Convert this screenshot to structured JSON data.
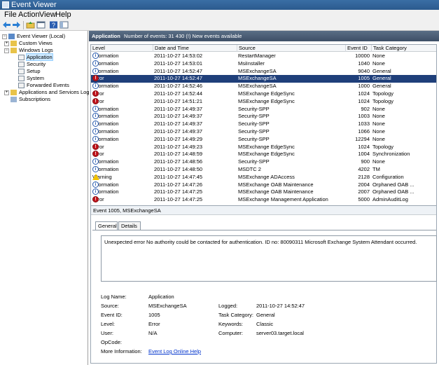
{
  "window": {
    "title": "Event Viewer"
  },
  "menu": [
    "File",
    "Action",
    "View",
    "Help"
  ],
  "toolbar_icons": [
    "back-icon",
    "forward-icon",
    "up-folder-icon",
    "properties-icon",
    "help-icon",
    "console-tree-icon"
  ],
  "tree": [
    {
      "label": "Event Viewer (Local)",
      "level": 0,
      "expander": "−",
      "icon": "event-viewer-icon"
    },
    {
      "label": "Custom Views",
      "level": 1,
      "expander": "+",
      "icon": "folder-icon"
    },
    {
      "label": "Windows Logs",
      "level": 1,
      "expander": "−",
      "icon": "folder-icon"
    },
    {
      "label": "Application",
      "level": 2,
      "expander": "",
      "icon": "log-icon",
      "selected": true
    },
    {
      "label": "Security",
      "level": 2,
      "expander": "",
      "icon": "log-icon"
    },
    {
      "label": "Setup",
      "level": 2,
      "expander": "",
      "icon": "log-icon"
    },
    {
      "label": "System",
      "level": 2,
      "expander": "",
      "icon": "log-icon"
    },
    {
      "label": "Forwarded Events",
      "level": 2,
      "expander": "",
      "icon": "log-icon"
    },
    {
      "label": "Applications and Services Logs",
      "level": 1,
      "expander": "+",
      "icon": "folder-icon"
    },
    {
      "label": "Subscriptions",
      "level": 1,
      "expander": "",
      "icon": "subscriptions-icon"
    }
  ],
  "pane": {
    "name": "Application",
    "count_text": "Number of events: 31 430 (!) New events available"
  },
  "columns": [
    "Level",
    "Date and Time",
    "Source",
    "Event ID",
    "Task Category"
  ],
  "events": [
    {
      "level": "Information",
      "date": "2011-10-27 14:53:02",
      "source": "RestartManager",
      "id": "10000",
      "category": "None"
    },
    {
      "level": "Information",
      "date": "2011-10-27 14:53:01",
      "source": "MsiInstaller",
      "id": "1040",
      "category": "None"
    },
    {
      "level": "Information",
      "date": "2011-10-27 14:52:47",
      "source": "MSExchangeSA",
      "id": "9040",
      "category": "General"
    },
    {
      "level": "Error",
      "date": "2011-10-27 14:52:47",
      "source": "MSExchangeSA",
      "id": "1005",
      "category": "General",
      "selected": true
    },
    {
      "level": "Information",
      "date": "2011-10-27 14:52:46",
      "source": "MSExchangeSA",
      "id": "1000",
      "category": "General"
    },
    {
      "level": "Error",
      "date": "2011-10-27 14:52:44",
      "source": "MSExchange EdgeSync",
      "id": "1024",
      "category": "Topology"
    },
    {
      "level": "Error",
      "date": "2011-10-27 14:51:21",
      "source": "MSExchange EdgeSync",
      "id": "1024",
      "category": "Topology"
    },
    {
      "level": "Information",
      "date": "2011-10-27 14:49:37",
      "source": "Security-SPP",
      "id": "902",
      "category": "None"
    },
    {
      "level": "Information",
      "date": "2011-10-27 14:49:37",
      "source": "Security-SPP",
      "id": "1003",
      "category": "None"
    },
    {
      "level": "Information",
      "date": "2011-10-27 14:49:37",
      "source": "Security-SPP",
      "id": "1033",
      "category": "None"
    },
    {
      "level": "Information",
      "date": "2011-10-27 14:49:37",
      "source": "Security-SPP",
      "id": "1066",
      "category": "None"
    },
    {
      "level": "Information",
      "date": "2011-10-27 14:49:29",
      "source": "Security-SPP",
      "id": "12294",
      "category": "None"
    },
    {
      "level": "Error",
      "date": "2011-10-27 14:49:23",
      "source": "MSExchange EdgeSync",
      "id": "1024",
      "category": "Topology"
    },
    {
      "level": "Error",
      "date": "2011-10-27 14:48:59",
      "source": "MSExchange EdgeSync",
      "id": "1004",
      "category": "Synchronization"
    },
    {
      "level": "Information",
      "date": "2011-10-27 14:48:56",
      "source": "Security-SPP",
      "id": "900",
      "category": "None"
    },
    {
      "level": "Information",
      "date": "2011-10-27 14:48:50",
      "source": "MSDTC 2",
      "id": "4202",
      "category": "TM"
    },
    {
      "level": "Warning",
      "date": "2011-10-27 14:47:45",
      "source": "MSExchange ADAccess",
      "id": "2128",
      "category": "Configuration"
    },
    {
      "level": "Information",
      "date": "2011-10-27 14:47:26",
      "source": "MSExchange OAB Maintenance",
      "id": "2004",
      "category": "Orphaned OAB ..."
    },
    {
      "level": "Information",
      "date": "2011-10-27 14:47:25",
      "source": "MSExchange OAB Maintenance",
      "id": "2007",
      "category": "Orphaned OAB ..."
    },
    {
      "level": "Error",
      "date": "2011-10-27 14:47:25",
      "source": "MSExchange Management Application",
      "id": "5000",
      "category": "AdminAuditLog"
    }
  ],
  "detail": {
    "title": "Event 1005, MSExchangeSA",
    "tabs": [
      "General",
      "Details"
    ],
    "message": "Unexpected error No authority could be contacted for authentication. ID no: 80090311 Microsoft Exchange System Attendant  occurred.",
    "fields": {
      "log_name_label": "Log Name:",
      "log_name": "Application",
      "source_label": "Source:",
      "source": "MSExchangeSA",
      "logged_label": "Logged:",
      "logged": "2011-10-27 14:52:47",
      "event_id_label": "Event ID:",
      "event_id": "1005",
      "task_label": "Task Category:",
      "task": "General",
      "level_label": "Level:",
      "level": "Error",
      "keywords_label": "Keywords:",
      "keywords": "Classic",
      "user_label": "User:",
      "user": "N/A",
      "computer_label": "Computer:",
      "computer": "server03.target.local",
      "opcode_label": "OpCode:",
      "opcode": "",
      "moreinfo_label": "More Information:",
      "moreinfo_link": "Event Log Online Help"
    }
  }
}
